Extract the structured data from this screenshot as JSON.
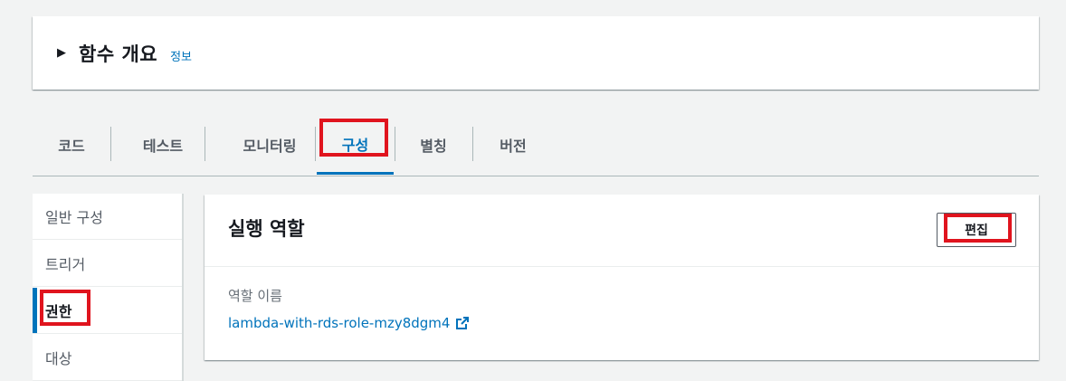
{
  "overview": {
    "title": "함수 개요",
    "info_link": "정보"
  },
  "tabs": [
    {
      "label": "코드"
    },
    {
      "label": "테스트"
    },
    {
      "label": "모니터링"
    },
    {
      "label": "구성",
      "active": true
    },
    {
      "label": "별칭"
    },
    {
      "label": "버전"
    }
  ],
  "sidenav": {
    "items": [
      {
        "label": "일반 구성"
      },
      {
        "label": "트리거"
      },
      {
        "label": "권한",
        "active": true
      },
      {
        "label": "대상"
      }
    ]
  },
  "panel": {
    "title": "실행 역할",
    "edit_label": "편집",
    "role_name_label": "역할 이름",
    "role_name_value": "lambda-with-rds-role-mzy8dgm4"
  },
  "colors": {
    "accent": "#0073bb",
    "highlight": "#e0141e",
    "background": "#f2f3f3"
  },
  "icons": {
    "caret": "caret-right-icon",
    "external": "external-link-icon"
  }
}
